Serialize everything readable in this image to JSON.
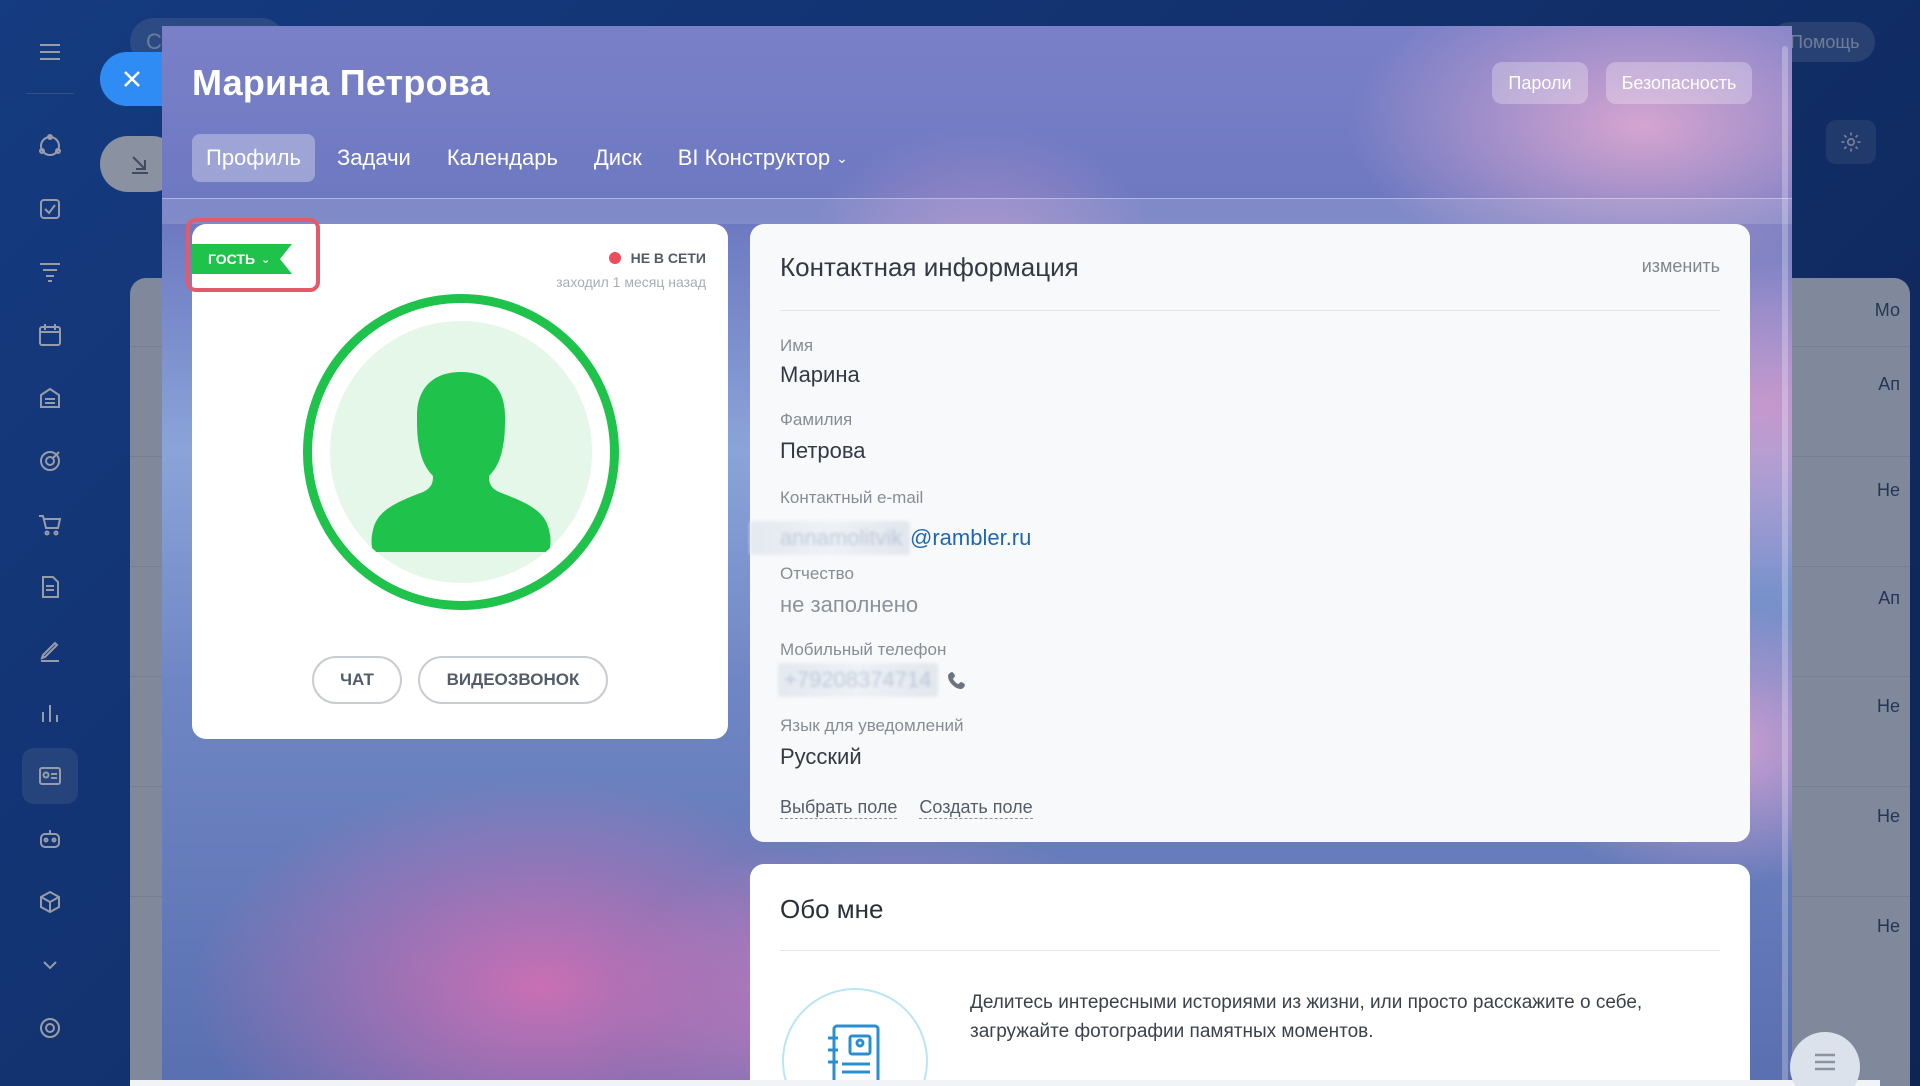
{
  "background": {
    "search_text": "С",
    "help_label": "Помощь",
    "table_cells": [
      "Мо",
      "Ап",
      "Не",
      "Ап",
      "Не",
      "Не",
      "Не"
    ]
  },
  "panel": {
    "user_name": "Марина Петрова",
    "buttons": {
      "passwords": "Пароли",
      "security": "Безопасность"
    },
    "tabs": [
      {
        "label": "Профиль",
        "active": true
      },
      {
        "label": "Задачи"
      },
      {
        "label": "Календарь"
      },
      {
        "label": "Диск"
      },
      {
        "label": "BI Конструктор",
        "dropdown": true
      }
    ]
  },
  "profile_card": {
    "role_badge": "ГОСТЬ",
    "status": "НЕ В СЕТИ",
    "last_seen": "заходил 1 месяц назад",
    "chat_button": "ЧАТ",
    "video_button": "ВИДЕОЗВОНОК",
    "colors": {
      "accent": "#1fc34b",
      "offline": "#ee4b5b",
      "highlight": "#e35b6b"
    }
  },
  "contact_card": {
    "title": "Контактная информация",
    "edit_label": "изменить",
    "fields": {
      "first_name_label": "Имя",
      "first_name": "Марина",
      "last_name_label": "Фамилия",
      "last_name": "Петрова",
      "email_label": "Контактный e-mail",
      "email_local_blurred": "annamolitvik",
      "email_domain": "@rambler.ru",
      "middle_name_label": "Отчество",
      "middle_name": "не заполнено",
      "phone_label": "Мобильный телефон",
      "phone_blurred": "+79208374714",
      "language_label": "Язык для уведомлений",
      "language": "Русский"
    },
    "select_field": "Выбрать поле",
    "create_field": "Создать поле"
  },
  "about_card": {
    "title": "Обо мне",
    "text": "Делитесь интересными историями из жизни, или просто расскажите о себе, загружайте фотографии памятных моментов."
  }
}
